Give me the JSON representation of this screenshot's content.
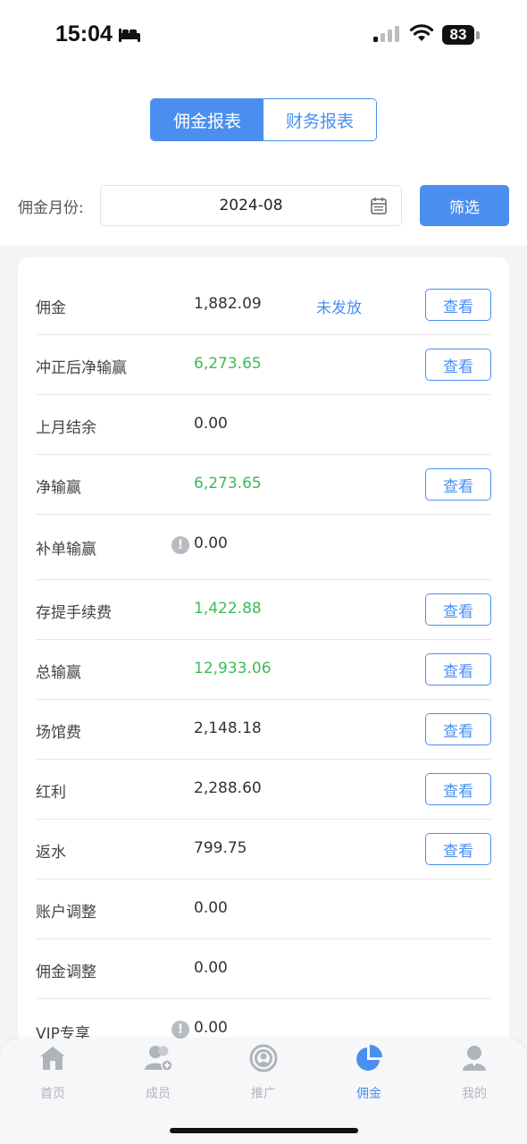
{
  "status_bar": {
    "time": "15:04",
    "battery": "83"
  },
  "tabs": [
    {
      "label": "佣金报表",
      "active": true
    },
    {
      "label": "财务报表",
      "active": false
    }
  ],
  "filter": {
    "month_label": "佣金月份:",
    "month_value": "2024-08",
    "button_label": "筛选"
  },
  "rows": [
    {
      "label": "佣金",
      "value": "1,882.09",
      "status": "未发放",
      "button": "查看"
    },
    {
      "label": "冲正后净输赢",
      "value": "6,273.65",
      "button": "查看"
    },
    {
      "label": "上月结余",
      "value": "0.00"
    },
    {
      "label": "净输赢",
      "value": "6,273.65",
      "button": "查看"
    },
    {
      "label": "补单输赢",
      "value": "0.00",
      "info": "!"
    },
    {
      "label": "存提手续费",
      "value": "1,422.88",
      "button": "查看"
    },
    {
      "label": "总输赢",
      "value": "12,933.06",
      "button": "查看"
    },
    {
      "label": "场馆费",
      "value": "2,148.18",
      "button": "查看"
    },
    {
      "label": "红利",
      "value": "2,288.60",
      "button": "查看"
    },
    {
      "label": "返水",
      "value": "799.75",
      "button": "查看"
    },
    {
      "label": "账户调整",
      "value": "0.00"
    },
    {
      "label": "佣金调整",
      "value": "0.00"
    },
    {
      "label": "VIP专享",
      "value": "0.00",
      "info": "!"
    }
  ],
  "nav": [
    {
      "label": "首页",
      "icon": "home-icon"
    },
    {
      "label": "成员",
      "icon": "members-icon"
    },
    {
      "label": "推广",
      "icon": "promote-icon"
    },
    {
      "label": "佣金",
      "icon": "pie-chart-icon",
      "active": true
    },
    {
      "label": "我的",
      "icon": "profile-icon"
    }
  ],
  "colors": {
    "accent": "#4a8ff0",
    "positive": "#3dbb55",
    "nav_inactive": "#b0b4ba"
  }
}
